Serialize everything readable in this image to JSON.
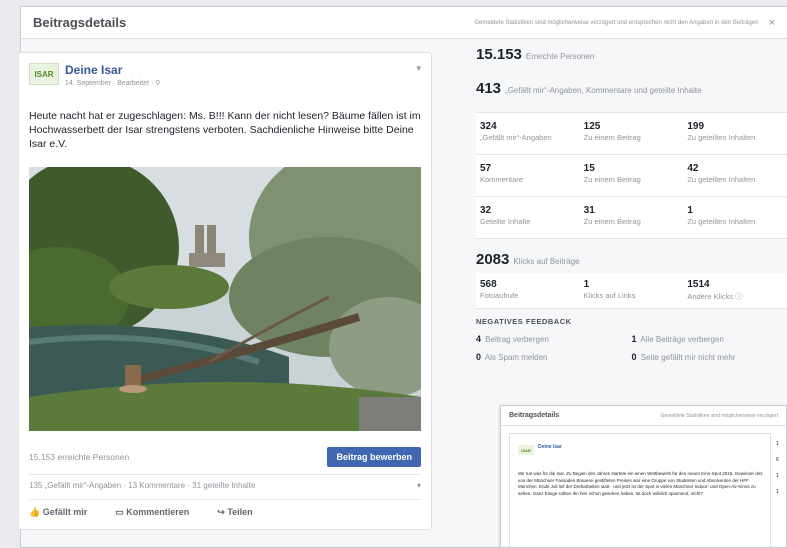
{
  "dialog": {
    "title": "Beitragsdetails",
    "note": "Gemeldete Statistiken sind möglicherweise verzögert und entsprechen nicht den Angaben in den Beiträgen",
    "close": "×"
  },
  "post": {
    "logo": "ISAR",
    "page_name": "Deine Isar",
    "meta": "14. September · Bearbeitet · ⚲",
    "text": "Heute nacht hat er zugeschlagen: Ms. B!!! Kann der nicht lesen? Bäume fällen ist im Hochwasserbett der Isar strengstens verboten. Sachdienliche Hinweise bitte Deine Isar e.V.",
    "reach_text": "15.153 erreichte Personen",
    "boost_label": "Beitrag bewerben",
    "counts": "135 „Gefällt mir“-Angaben · 13 Kommentare · 31 geteilte Inhalte",
    "lang": "▾",
    "actions": {
      "like": "Gefällt mir",
      "comment": "Kommentieren",
      "share": "Teilen"
    }
  },
  "stats": {
    "reach": {
      "num": "15.153",
      "label": "Erreichte Personen"
    },
    "engagement": {
      "num": "413",
      "label": "„Gefällt mir“-Angaben, Kommentare und geteilte Inhalte"
    },
    "rows": [
      [
        {
          "v": "324",
          "l": "„Gefällt mir“-Angaben"
        },
        {
          "v": "125",
          "l": "Zu einem Beitrag"
        },
        {
          "v": "199",
          "l": "Zu geteilten Inhalten"
        }
      ],
      [
        {
          "v": "57",
          "l": "Kommentare"
        },
        {
          "v": "15",
          "l": "Zu einem Beitrag"
        },
        {
          "v": "42",
          "l": "Zu geteilten Inhalten"
        }
      ],
      [
        {
          "v": "32",
          "l": "Geteilte Inhalte"
        },
        {
          "v": "31",
          "l": "Zu einem Beitrag"
        },
        {
          "v": "1",
          "l": "Zu geteilten Inhalten"
        }
      ]
    ],
    "clicks": {
      "num": "2083",
      "label": "Klicks auf Beiträge"
    },
    "click_row": [
      {
        "v": "568",
        "l": "Fotoaufrufe"
      },
      {
        "v": "1",
        "l": "Klicks auf Links"
      },
      {
        "v": "1514",
        "l": "Andere Klicks ⓘ"
      }
    ],
    "neg_title": "NEGATIVES FEEDBACK",
    "neg": [
      {
        "v": "4",
        "l": "Beitrag verbergen"
      },
      {
        "v": "1",
        "l": "Alle Beiträge verbergen"
      },
      {
        "v": "0",
        "l": "Als Spam melden"
      },
      {
        "v": "0",
        "l": "Seite gefällt mir nicht mehr"
      }
    ]
  },
  "thumb": {
    "title": "Beitragsdetails",
    "note": "Gemeldete Statistiken sind möglicherweise verzögert",
    "logo": "ISAR",
    "name": "Deine Isar",
    "text": "Wir tun was für die Isar. Zu Beginn des Jahres startete ein einen Wettbewerb für den neuen Kino-Spot 2015. Gewinner des von der Münchner Fassaden Brauerei gestifteten Preises war eine Gruppe von Studenten und Absolventen der HFF München. Ende Juli lief der Dreharbeiten statt - und jetzt ist der Spot in vielen Münchner Indoor- und Open-Air-Kinos zu sehen. Ganz Einige sollten ihn hier schon gesehen haben. Ist doch wirklich spannend, nicht?",
    "side": "1\n6\n1\n1"
  }
}
